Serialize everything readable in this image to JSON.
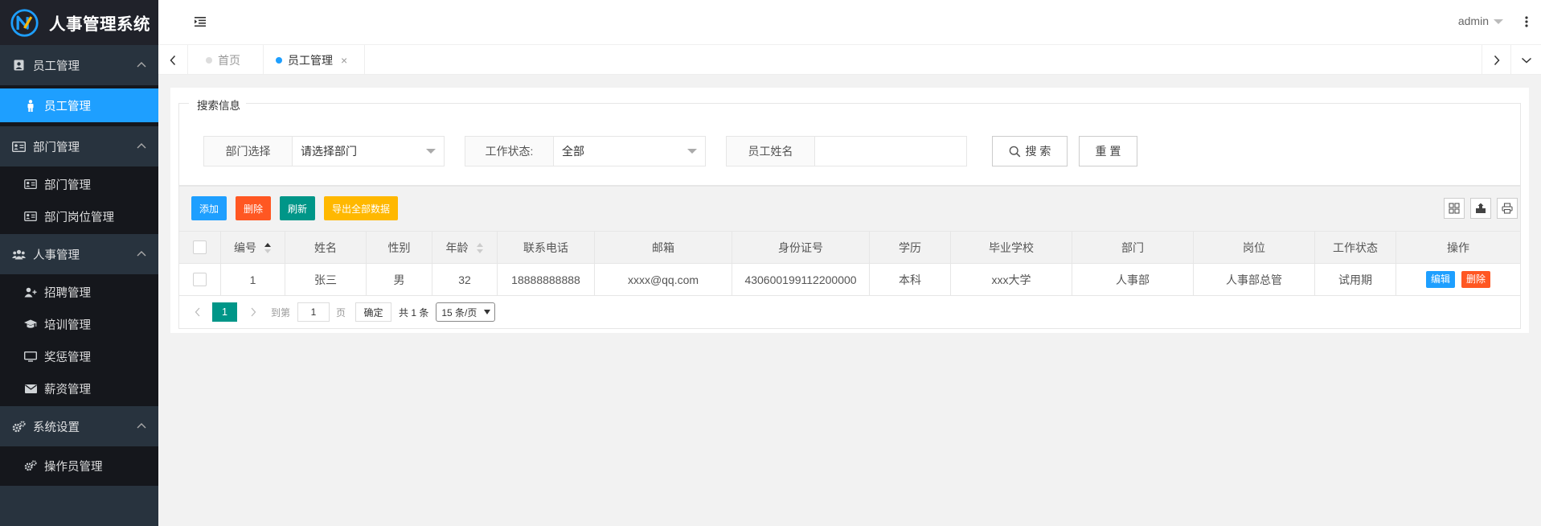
{
  "app": {
    "title": "人事管理系统"
  },
  "sidebar": {
    "groups": [
      {
        "label": "员工管理",
        "items": [
          {
            "label": "员工管理"
          }
        ]
      },
      {
        "label": "部门管理",
        "items": [
          {
            "label": "部门管理"
          },
          {
            "label": "部门岗位管理"
          }
        ]
      },
      {
        "label": "人事管理",
        "items": [
          {
            "label": "招聘管理"
          },
          {
            "label": "培训管理"
          },
          {
            "label": "奖惩管理"
          },
          {
            "label": "薪资管理"
          }
        ]
      },
      {
        "label": "系统设置",
        "items": [
          {
            "label": "操作员管理"
          }
        ]
      }
    ]
  },
  "header": {
    "user": "admin"
  },
  "tabs": [
    {
      "label": "首页"
    },
    {
      "label": "员工管理",
      "close": "×"
    }
  ],
  "search": {
    "legend": "搜索信息",
    "dept_label": "部门选择",
    "dept_value": "请选择部门",
    "status_label": "工作状态:",
    "status_value": "全部",
    "name_label": "员工姓名",
    "name_value": "",
    "search_button": "搜 索",
    "reset_button": "重 置"
  },
  "toolbar": {
    "add": "添加",
    "delete": "删除",
    "refresh": "刷新",
    "export": "导出全部数据"
  },
  "table": {
    "columns": [
      "编号",
      "姓名",
      "性别",
      "年龄",
      "联系电话",
      "邮箱",
      "身份证号",
      "学历",
      "毕业学校",
      "部门",
      "岗位",
      "工作状态",
      "操作"
    ],
    "rows": [
      [
        "1",
        "张三",
        "男",
        "32",
        "18888888888",
        "xxxx@qq.com",
        "430600199112200000",
        "本科",
        "xxx大学",
        "人事部",
        "人事部总管",
        "试用期"
      ]
    ],
    "row_actions": {
      "edit": "编辑",
      "delete": "删除"
    }
  },
  "pager": {
    "current_page": "1",
    "goto_label": "到第",
    "goto_value": "1",
    "page_unit": "页",
    "confirm": "确定",
    "total": "共 1 条",
    "page_size": "15 条/页"
  },
  "colors": {
    "sidebar_bg": "#28333e",
    "active_blue": "#1e9fff",
    "danger": "#ff5722",
    "teal": "#009688",
    "warn": "#ffb800"
  }
}
